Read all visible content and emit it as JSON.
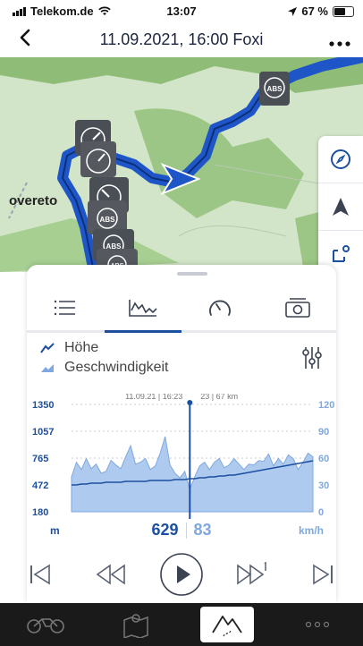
{
  "status": {
    "carrier": "Telekom.de",
    "time": "13:07",
    "battery": "67 %",
    "battery_level": 0.67
  },
  "nav": {
    "back_icon": "chevron-left",
    "title": "11.09.2021, 16:00 Foxi",
    "more_icon": "ellipsis"
  },
  "map": {
    "place_label": "overeto",
    "buttons": [
      "compass-icon",
      "navigation-arrow-icon",
      "route-crop-icon"
    ]
  },
  "tabs": [
    {
      "icon": "list-icon",
      "active": false
    },
    {
      "icon": "elevation-chart-icon",
      "active": true
    },
    {
      "icon": "speedometer-icon",
      "active": false
    },
    {
      "icon": "photo-gallery-icon",
      "active": false
    }
  ],
  "legend": {
    "elevation": "Höhe",
    "speed": "Geschwindigkeit"
  },
  "chart_data": {
    "type": "area",
    "series": [
      {
        "name": "Höhe",
        "axis": "left",
        "values": [
          560,
          720,
          640,
          760,
          650,
          700,
          600,
          620,
          740,
          690,
          650,
          780,
          900,
          700,
          720,
          760,
          640,
          680,
          820,
          1000,
          690,
          600,
          550,
          620,
          420,
          560,
          680,
          720,
          640,
          720,
          760,
          660,
          690,
          760,
          700,
          640,
          700,
          690,
          740,
          730,
          810,
          680,
          760,
          700,
          800,
          760,
          640,
          720,
          820,
          780
        ]
      },
      {
        "name": "Geschwindigkeit",
        "axis": "right",
        "values": [
          30,
          30,
          31,
          31,
          32,
          32,
          32,
          33,
          33,
          33,
          33,
          34,
          34,
          34,
          34,
          34,
          35,
          35,
          35,
          35,
          35,
          36,
          36,
          36,
          37,
          37,
          38,
          38,
          39,
          39,
          40,
          40,
          41,
          41,
          42,
          43,
          44,
          45,
          46,
          47,
          48,
          49,
          50,
          51,
          52,
          53,
          54,
          55,
          56,
          57
        ]
      }
    ],
    "y_left_ticks": [
      "1350",
      "1057",
      "765",
      "472",
      "180"
    ],
    "y_left_range": [
      180,
      1350
    ],
    "y_right_ticks": [
      "120",
      "90",
      "60",
      "30",
      "0"
    ],
    "y_right_range": [
      0,
      120
    ],
    "cursor_fraction": 0.49,
    "cursor_label_left": "11.09.21 | 16:23",
    "cursor_label_right": "23 | 67 km",
    "left_unit": "m",
    "right_unit": "km/h",
    "elevation_color": "#1d4fa0",
    "speed_color": "#7fa8e0",
    "grid": true
  },
  "readout": {
    "elevation": "629",
    "speed": "83"
  },
  "player": [
    "skip-to-start-icon",
    "rewind-icon",
    "play-icon",
    "forward-one-icon",
    "skip-to-end-icon"
  ],
  "bottom_nav": [
    {
      "icon": "motorcycle-icon",
      "active": false
    },
    {
      "icon": "map-pin-icon",
      "active": false
    },
    {
      "icon": "mountain-route-icon",
      "active": true
    },
    {
      "icon": "more-dots-icon",
      "active": false
    }
  ],
  "colors": {
    "accent": "#1d4fa0",
    "route": "#1e56c8",
    "dark_bar": "#1a1a1a"
  }
}
